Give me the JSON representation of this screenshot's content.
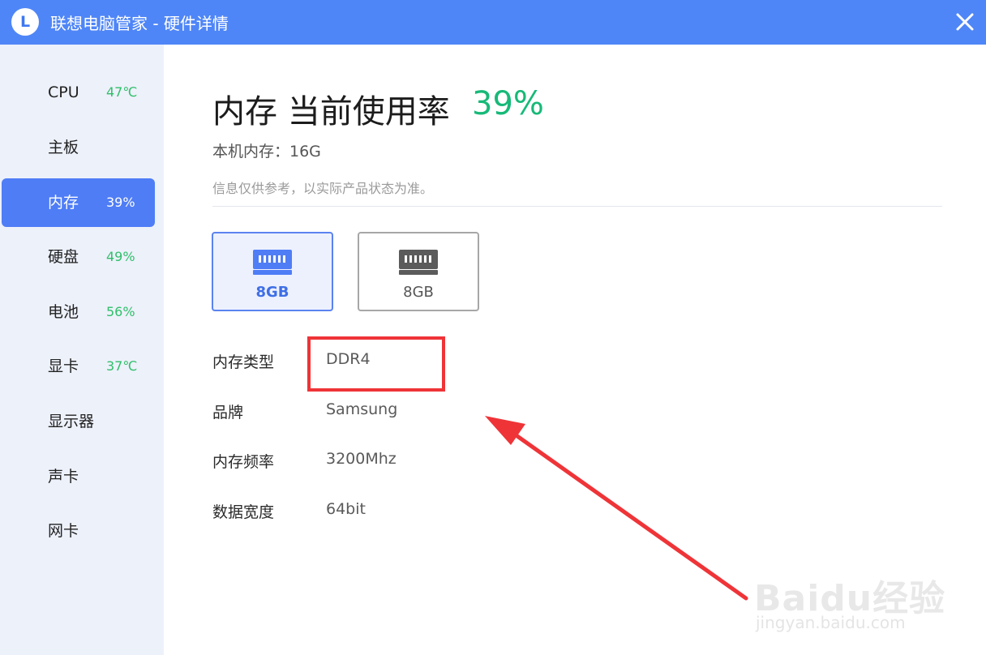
{
  "app": {
    "title": "联想电脑管家 - 硬件详情",
    "logo_letter": "L",
    "logo_icon": "lenovo-l-logo-icon",
    "close_icon": "close-icon",
    "accent_color": "#4f86f7"
  },
  "sidebar": {
    "items": [
      {
        "label": "CPU",
        "value": "47℃",
        "active": false
      },
      {
        "label": "主板",
        "value": "",
        "active": false
      },
      {
        "label": "内存",
        "value": "39%",
        "active": true
      },
      {
        "label": "硬盘",
        "value": "49%",
        "active": false
      },
      {
        "label": "电池",
        "value": "56%",
        "active": false
      },
      {
        "label": "显卡",
        "value": "37℃",
        "active": false
      },
      {
        "label": "显示器",
        "value": "",
        "active": false
      },
      {
        "label": "声卡",
        "value": "",
        "active": false
      },
      {
        "label": "网卡",
        "value": "",
        "active": false
      }
    ],
    "active_color": "#4f7df6",
    "value_color": "#2fbf6a"
  },
  "main": {
    "title": "内存 当前使用率",
    "usage": "39%",
    "usage_color": "#17b978",
    "capacity": "本机内存：16G",
    "disclaimer": "信息仅供参考，以实际产品状态为准。",
    "slots": [
      {
        "label": "8GB",
        "selected": true,
        "icon": "memory-module-icon"
      },
      {
        "label": "8GB",
        "selected": false,
        "icon": "memory-module-icon"
      }
    ],
    "specs": [
      {
        "key": "内存类型",
        "value": "DDR4"
      },
      {
        "key": "品牌",
        "value": "Samsung"
      },
      {
        "key": "内存频率",
        "value": "3200Mhz"
      },
      {
        "key": "数据宽度",
        "value": "64bit"
      }
    ]
  },
  "annotation": {
    "highlight_color": "#ef3438",
    "arrow_color": "#ef3438"
  },
  "watermark": {
    "brand": "Baidu经验",
    "url": "jingyan.baidu.com"
  }
}
